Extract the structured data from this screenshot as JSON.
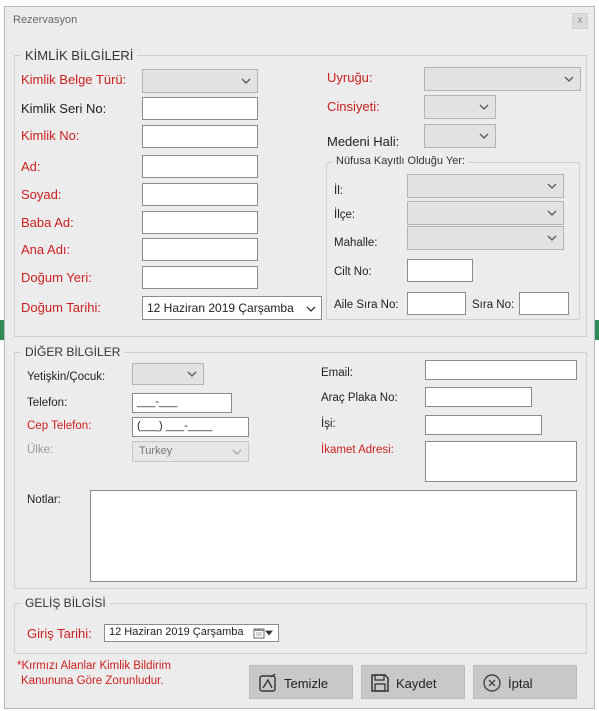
{
  "window": {
    "title": "Rezervasyon",
    "close_label": "x"
  },
  "identity": {
    "legend": "KİMLİK BİLGİLERİ",
    "labels": {
      "doc_type": "Kimlik Belge Türü:",
      "serial_no": "Kimlik Seri No:",
      "id_no": "Kimlik No:",
      "name": "Ad:",
      "surname": "Soyad:",
      "father": "Baba Ad:",
      "mother": "Ana Adı:",
      "birth_place": "Doğum Yeri:",
      "birth_date": "Doğum Tarihi:",
      "nationality": "Uyruğu:",
      "gender": "Cinsiyeti:",
      "marital": "Medeni Hali:"
    },
    "birth_date_value": "12 Haziran 2019 Çarşamba",
    "registry": {
      "legend": "Nüfusa Kayıtlı Olduğu Yer:",
      "province": "İl:",
      "district": "İlçe:",
      "neighborhood": "Mahalle:",
      "volume": "Cilt No:",
      "family_no": "Aile Sıra No:",
      "sequence_no": "Sıra No:"
    }
  },
  "other": {
    "legend": "DİĞER BİLGİLER",
    "labels": {
      "adult_child": "Yetişkin/Çocuk:",
      "phone": "Telefon:",
      "mobile": "Cep Telefon:",
      "country": "Ülke:",
      "notes": "Notlar:",
      "email": "Email:",
      "plate": "Araç Plaka No:",
      "job": "İşi:",
      "address": "İkamet Adresi:"
    },
    "phone_mask": "___-___",
    "mobile_mask": "(___) ___-____",
    "country_value": "Turkey"
  },
  "arrival": {
    "legend": "GELİŞ BİLGİSİ",
    "label": "Giriş Tarihi:",
    "value": "12 Haziran 2019 Çarşamba"
  },
  "footer": {
    "note_line1": "*Kırmızı Alanlar Kimlik Bildirim",
    "note_line2": "Kanununa Göre Zorunludur.",
    "clear": "Temizle",
    "save": "Kaydet",
    "cancel": "İptal"
  },
  "colors": {
    "required": "#cc1f1f",
    "window_bg": "#ececec",
    "button_bg": "#c8c8c8"
  }
}
